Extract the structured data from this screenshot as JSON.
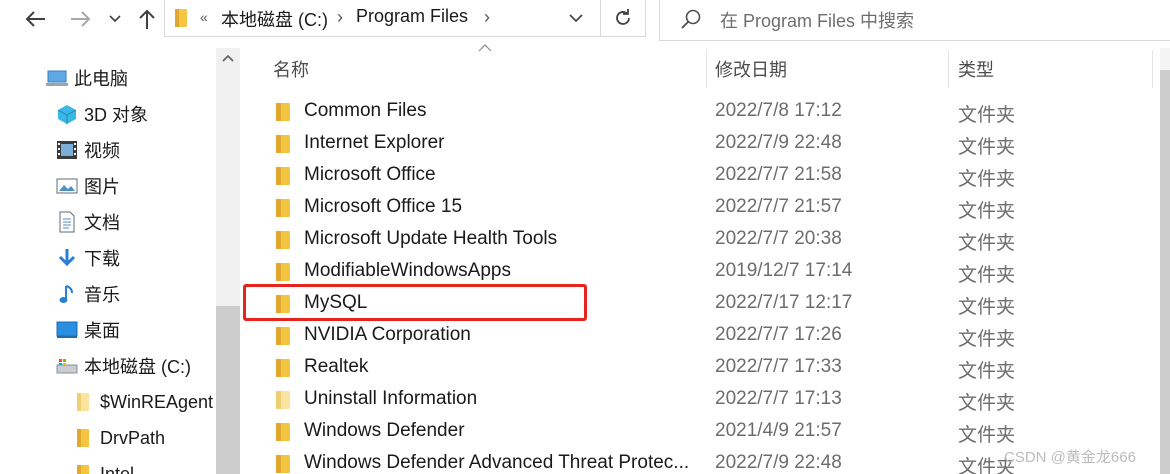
{
  "toolbar": {
    "back_icon": "back-arrow-icon",
    "forward_icon": "forward-arrow-icon",
    "recent_icon": "chevron-down-icon",
    "up_icon": "up-arrow-icon"
  },
  "address": {
    "chevron": "«",
    "crumbs": [
      "本地磁盘 (C:)",
      "Program Files"
    ],
    "separator": "›"
  },
  "search": {
    "placeholder": "在 Program Files 中搜索"
  },
  "nav": {
    "items": [
      {
        "label": "此电脑",
        "icon": "computer-icon"
      },
      {
        "label": "3D 对象",
        "icon": "cube-icon"
      },
      {
        "label": "视频",
        "icon": "video-icon"
      },
      {
        "label": "图片",
        "icon": "picture-icon"
      },
      {
        "label": "文档",
        "icon": "document-icon"
      },
      {
        "label": "下载",
        "icon": "download-icon"
      },
      {
        "label": "音乐",
        "icon": "music-icon"
      },
      {
        "label": "桌面",
        "icon": "desktop-icon"
      },
      {
        "label": "本地磁盘 (C:)",
        "icon": "drive-icon"
      },
      {
        "label": "$WinREAgent",
        "icon": "folder-icon"
      },
      {
        "label": "DrvPath",
        "icon": "folder-icon"
      },
      {
        "label": "Intel",
        "icon": "folder-icon"
      }
    ]
  },
  "columns": {
    "name": "名称",
    "date": "修改日期",
    "type": "类型"
  },
  "files": [
    {
      "name": "Common Files",
      "date": "2022/7/8 17:12",
      "type": "文件夹"
    },
    {
      "name": "Internet Explorer",
      "date": "2022/7/9 22:48",
      "type": "文件夹"
    },
    {
      "name": "Microsoft Office",
      "date": "2022/7/7 21:58",
      "type": "文件夹"
    },
    {
      "name": "Microsoft Office 15",
      "date": "2022/7/7 21:57",
      "type": "文件夹"
    },
    {
      "name": "Microsoft Update Health Tools",
      "date": "2022/7/7 20:38",
      "type": "文件夹"
    },
    {
      "name": "ModifiableWindowsApps",
      "date": "2019/12/7 17:14",
      "type": "文件夹"
    },
    {
      "name": "MySQL",
      "date": "2022/7/17 12:17",
      "type": "文件夹"
    },
    {
      "name": "NVIDIA Corporation",
      "date": "2022/7/7 17:26",
      "type": "文件夹"
    },
    {
      "name": "Realtek",
      "date": "2022/7/7 17:33",
      "type": "文件夹"
    },
    {
      "name": "Uninstall Information",
      "date": "2022/7/7 17:13",
      "type": "文件夹"
    },
    {
      "name": "Windows Defender",
      "date": "2021/4/9 21:57",
      "type": "文件夹"
    },
    {
      "name": "Windows Defender Advanced Threat Protec...",
      "date": "2022/7/9 22:48",
      "type": "文件夹"
    }
  ],
  "highlighted_item": "MySQL",
  "watermark": "CSDN @黄金龙666",
  "colors": {
    "folder": "#f5c542",
    "folder_dark": "#e0a82e",
    "highlight": "#e8231e",
    "accent": "#0078d7"
  }
}
